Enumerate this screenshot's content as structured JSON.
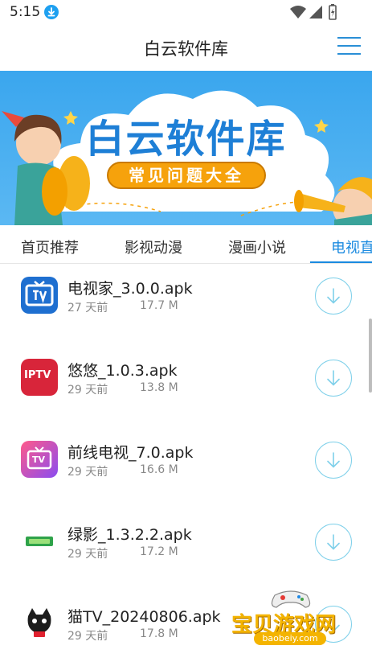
{
  "status_bar": {
    "time": "5:15",
    "icons": [
      "download-notification-icon",
      "wifi-icon",
      "signal-icon",
      "battery-icon"
    ]
  },
  "header": {
    "title": "白云软件库",
    "menu_icon": "hamburger-menu-icon"
  },
  "banner": {
    "title": "白云软件库",
    "subtitle": "常见问题大全"
  },
  "tabs": [
    {
      "label": "首页推荐",
      "active": false
    },
    {
      "label": "影视动漫",
      "active": false
    },
    {
      "label": "漫画小说",
      "active": false
    },
    {
      "label": "电视直",
      "active": true
    }
  ],
  "apps": [
    {
      "name": "电视家_3.0.0.apk",
      "age": "27 天前",
      "size": "17.7 M",
      "icon": "tv-app-icon"
    },
    {
      "name": "悠悠_1.0.3.apk",
      "age": "29 天前",
      "size": "13.8 M",
      "icon": "iptv-app-icon",
      "icon_text": "IPTV"
    },
    {
      "name": "前线电视_7.0.apk",
      "age": "29 天前",
      "size": "16.6 M",
      "icon": "tv-gradient-app-icon",
      "icon_text": "TV"
    },
    {
      "name": "绿影_1.3.2.2.apk",
      "age": "29 天前",
      "size": "17.2 M",
      "icon": "green-app-icon"
    },
    {
      "name": "猫TV_20240806.apk",
      "age": "29 天前",
      "size": "17.8 M",
      "icon": "cat-tv-app-icon"
    }
  ],
  "watermark": {
    "text": "宝贝游戏网",
    "url": "baobeiy.com"
  },
  "colors": {
    "accent": "#1a8ae0",
    "download_ring": "#7fd0ea",
    "banner_blue": "#3aa6ee",
    "pill_orange": "#f6a20c"
  }
}
